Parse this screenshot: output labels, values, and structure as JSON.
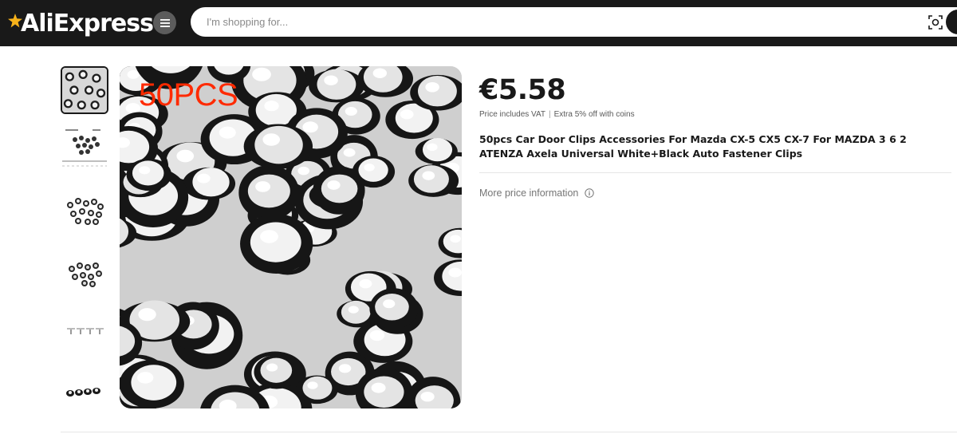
{
  "header": {
    "logo_text": "AliExpress",
    "search_placeholder": "I'm shopping for...",
    "icons": [
      "menu-icon",
      "camera-search-icon"
    ]
  },
  "gallery": {
    "overlay_text": "50PCS",
    "thumbnail_count": 6,
    "active_thumbnail": 1
  },
  "product": {
    "price": "€5.58",
    "vat_note": "Price includes VAT",
    "separator": "|",
    "coins_note": "Extra 5% off with coins",
    "title": "50pcs Car Door Clips Accessories For Mazda CX-5 CX5 CX-7 For MAZDA 3 6 2 ATENZA Axela Universal White+Black Auto Fastener Clips",
    "more_price_info": "More price information"
  },
  "colors": {
    "header_bg": "#191919",
    "overlay_text": "#ff2a00",
    "logo_star": "#f7b21a"
  }
}
